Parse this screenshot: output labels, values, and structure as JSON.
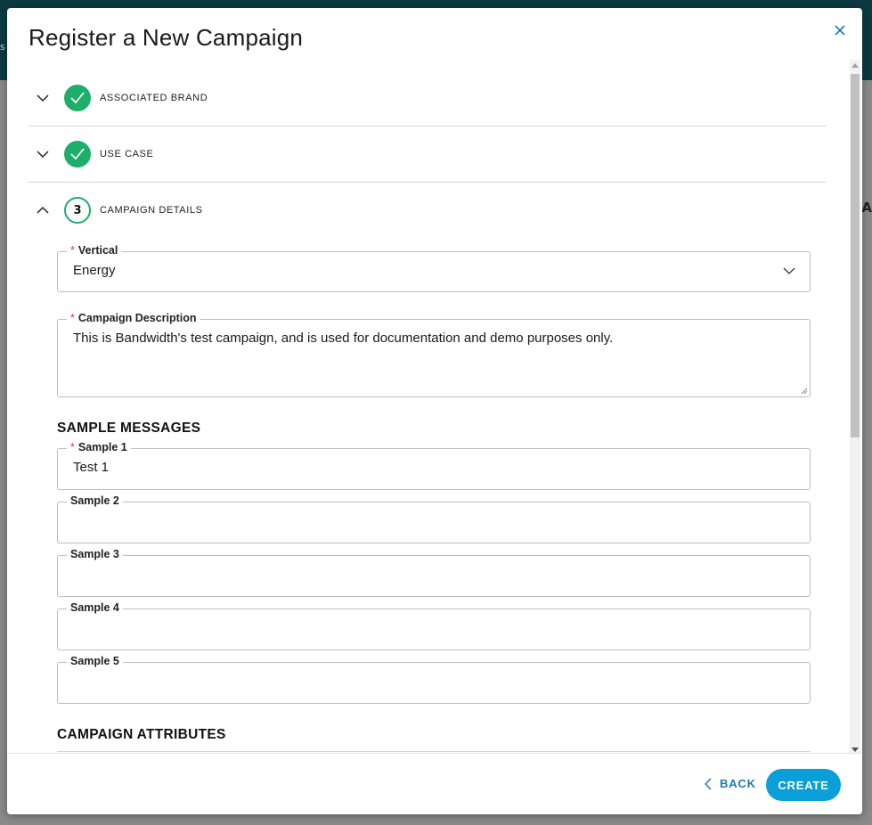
{
  "background": {
    "s_fragment": "s",
    "a_fragment": "A"
  },
  "modal": {
    "title": "Register a New Campaign",
    "steps": [
      {
        "label": "ASSOCIATED BRAND",
        "state": "complete"
      },
      {
        "label": "USE CASE",
        "state": "complete"
      },
      {
        "label": "CAMPAIGN DETAILS",
        "state": "active",
        "number": "3"
      }
    ],
    "vertical": {
      "label": "Vertical",
      "required": "*",
      "value": "Energy"
    },
    "description": {
      "label": "Campaign Description",
      "required": "*",
      "value": "This is Bandwidth's test campaign, and is used for documentation and demo purposes only."
    },
    "sample_messages": {
      "heading": "SAMPLE MESSAGES",
      "samples": [
        {
          "label": "Sample 1",
          "required": "*",
          "value": "Test 1"
        },
        {
          "label": "Sample 2",
          "value": ""
        },
        {
          "label": "Sample 3",
          "value": ""
        },
        {
          "label": "Sample 4",
          "value": ""
        },
        {
          "label": "Sample 5",
          "value": ""
        }
      ]
    },
    "campaign_attributes": {
      "heading": "CAMPAIGN ATTRIBUTES"
    },
    "footer": {
      "back_label": "BACK",
      "create_label": "CREATE"
    }
  },
  "colors": {
    "success": "#1eae6b",
    "primary": "#0a9fd8",
    "link": "#1a7ab8",
    "required": "#d0452b"
  },
  "icons": [
    "close-icon",
    "chevron-down-icon",
    "chevron-up-icon",
    "checkmark-icon",
    "chevron-left-icon"
  ]
}
